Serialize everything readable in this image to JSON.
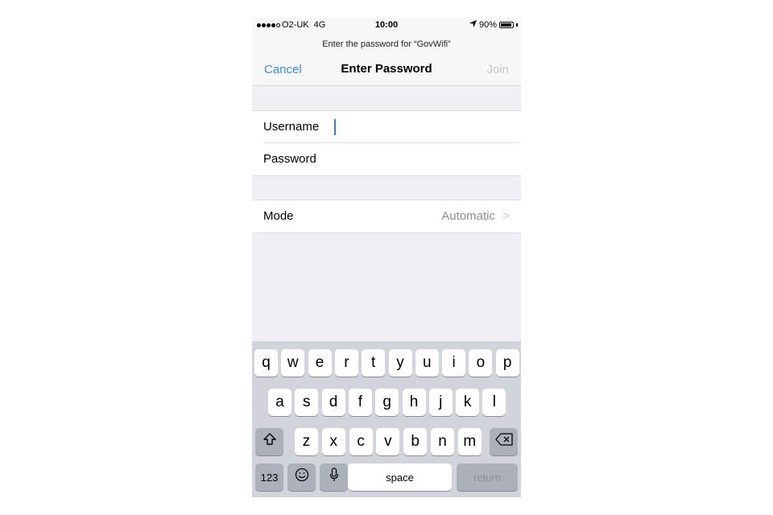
{
  "status": {
    "carrier": "O2-UK",
    "network": "4G",
    "time": "10:00",
    "battery": "90%"
  },
  "header": {
    "prompt": "Enter the password for “GovWifi”",
    "cancel": "Cancel",
    "title": "Enter Password",
    "join": "Join"
  },
  "form": {
    "username_label": "Username",
    "password_label": "Password"
  },
  "mode": {
    "label": "Mode",
    "value": "Automatic",
    "chevron": ">"
  },
  "keyboard": {
    "row1": [
      "q",
      "w",
      "e",
      "r",
      "t",
      "y",
      "u",
      "i",
      "o",
      "p"
    ],
    "row2": [
      "a",
      "s",
      "d",
      "f",
      "g",
      "h",
      "j",
      "k",
      "l"
    ],
    "row3": [
      "z",
      "x",
      "c",
      "v",
      "b",
      "n",
      "m"
    ],
    "numbers": "123",
    "space": "space",
    "return": "return"
  },
  "colors": {
    "accent": "#3d8ee6",
    "disabled": "#c7c7cc",
    "keyboard_bg": "#d1d5db"
  }
}
